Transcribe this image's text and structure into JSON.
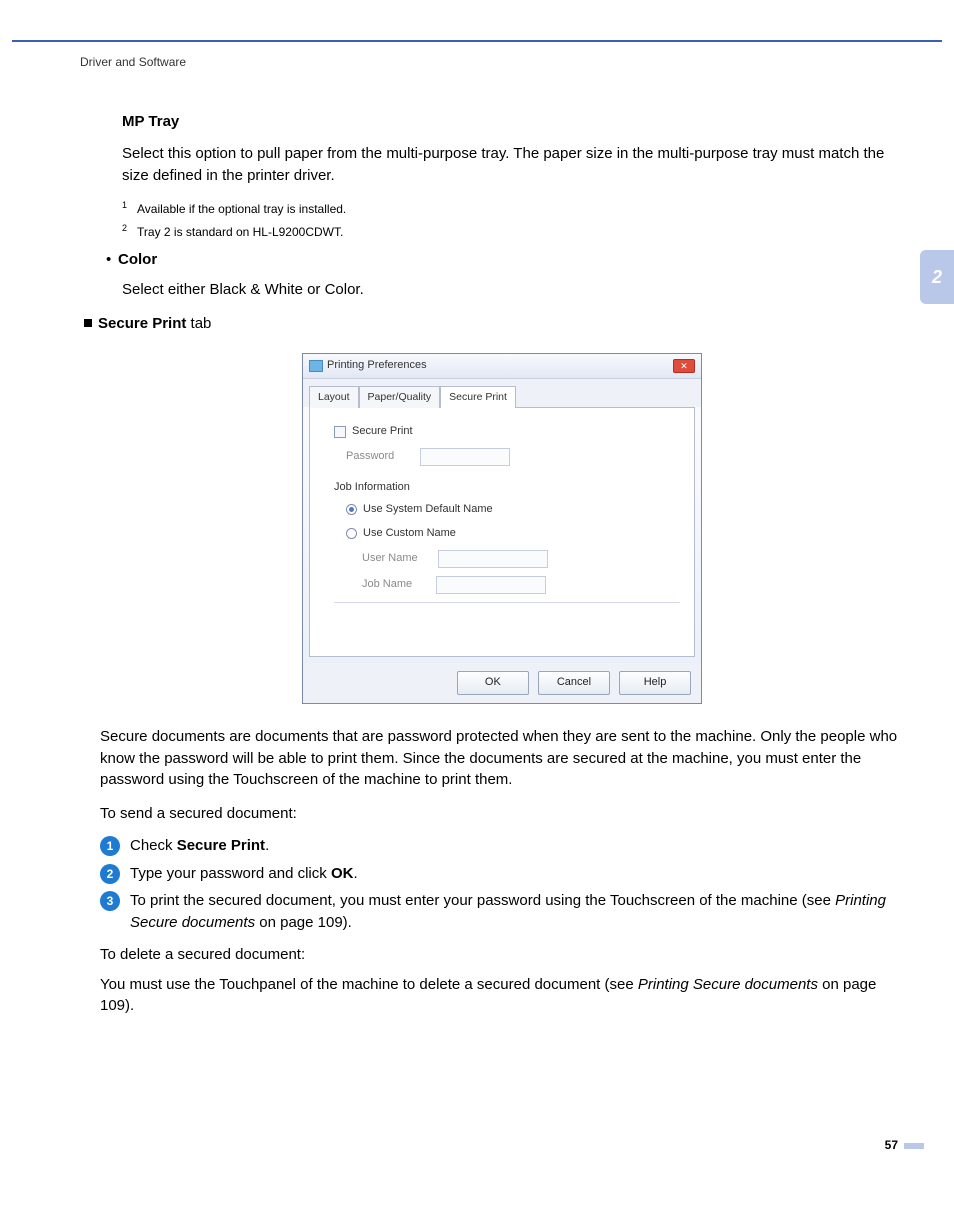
{
  "header": {
    "breadcrumb": "Driver and Software"
  },
  "section_tab": "2",
  "mp_tray": {
    "title": "MP Tray",
    "desc": "Select this option to pull paper from the multi-purpose tray. The paper size in the multi-purpose tray must match the size defined in the printer driver."
  },
  "footnotes": {
    "n1_sup": "1",
    "n1_text": "Available if the optional tray is installed.",
    "n2_sup": "2",
    "n2_text": "Tray 2 is standard on HL-L9200CDWT."
  },
  "color": {
    "bullet": "•",
    "title": "Color",
    "desc": "Select either Black & White or Color."
  },
  "secure_tab": {
    "label": "Secure Print",
    "suffix": " tab"
  },
  "dialog": {
    "title": "Printing Preferences",
    "close_glyph": "✕",
    "tabs": {
      "layout": "Layout",
      "paper": "Paper/Quality",
      "secure": "Secure Print"
    },
    "secure_checkbox": "Secure Print",
    "password_label": "Password",
    "job_info_title": "Job Information",
    "radio_default": "Use System Default Name",
    "radio_custom": "Use Custom Name",
    "user_name_label": "User Name",
    "job_name_label": "Job Name",
    "buttons": {
      "ok": "OK",
      "cancel": "Cancel",
      "help": "Help"
    }
  },
  "secure_para": "Secure documents are documents that are password protected when they are sent to the machine. Only the people who know the password will be able to print them. Since the documents are secured at the machine, you must enter the password using the Touchscreen of the machine to print them.",
  "send_intro": "To send a secured document:",
  "steps": {
    "s1_num": "1",
    "s1_pre": "Check ",
    "s1_bold": "Secure Print",
    "s1_post": ".",
    "s2_num": "2",
    "s2_pre": "Type your password and click ",
    "s2_bold": "OK",
    "s2_post": ".",
    "s3_num": "3",
    "s3_pre": "To print the secured document, you must enter your password using the Touchscreen of the machine (see ",
    "s3_link": "Printing Secure documents",
    "s3_post": " on page 109)."
  },
  "delete_intro": "To delete a secured document:",
  "delete_para_pre": "You must use the Touchpanel of the machine to delete a secured document (see ",
  "delete_para_link": "Printing Secure documents",
  "delete_para_post": " on page 109).",
  "page_number": "57"
}
